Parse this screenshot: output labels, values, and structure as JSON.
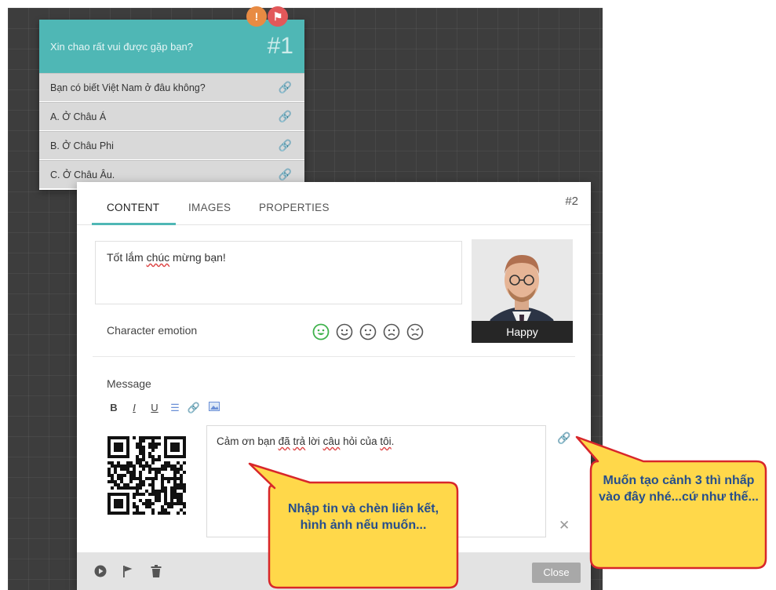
{
  "scene1": {
    "title": "Xin chao rất vui được gặp bạn?",
    "number": "#1",
    "badges": {
      "warning": "!",
      "flag": "⚑"
    },
    "options": [
      {
        "label": "Bạn có biết Việt Nam ở đâu không?",
        "icon": "link-icon"
      },
      {
        "label": "A. Ở Châu Á",
        "icon": "link-icon"
      },
      {
        "label": "B. Ở Châu Phi",
        "icon": "link-icon"
      },
      {
        "label": "C. Ở Châu Âu.",
        "icon": "link-icon"
      }
    ]
  },
  "scene2": {
    "number": "#2",
    "tabs": [
      "CONTENT",
      "IMAGES",
      "PROPERTIES"
    ],
    "active_tab": "CONTENT",
    "content_text_parts": [
      "Tốt lắm ",
      "chúc",
      " mừng bạn!"
    ],
    "character_emotion_label": "Character emotion",
    "emotions": [
      "happy",
      "smile",
      "neutral",
      "sad",
      "angry"
    ],
    "selected_emotion": "happy",
    "photo_caption": "Happy",
    "message_label": "Message",
    "toolbar": {
      "bold": "B",
      "italic": "I",
      "underline": "U"
    },
    "message_parts": [
      "Cảm ơn bạn ",
      "đã",
      " ",
      "trả",
      " lời ",
      "câu",
      " hỏi của ",
      "tôi",
      "."
    ],
    "close_label": "Close"
  },
  "callouts": {
    "left": "Nhập tin và chèn liên kết, hình ảnh nếu muốn...",
    "right": "Muốn tạo cảnh 3 thì nhấp vào đây nhé...cứ như thế..."
  },
  "colors": {
    "teal": "#4fb7b5",
    "canvas": "#3d3d3d",
    "callout_fill": "#ffd84a",
    "callout_border": "#d8262a",
    "callout_text": "#264e8c"
  }
}
